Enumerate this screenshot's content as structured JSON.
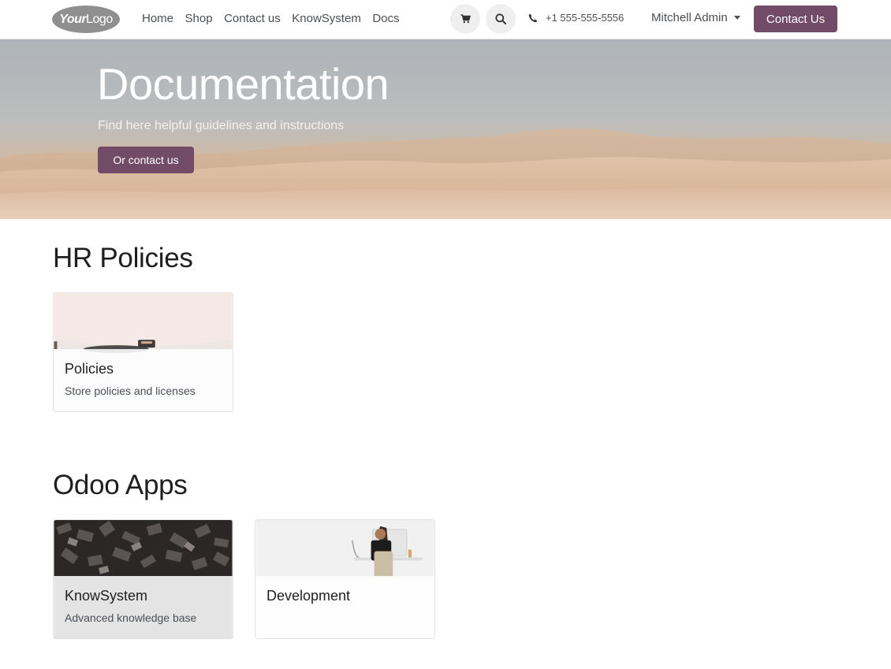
{
  "header": {
    "logo_bold": "Your",
    "logo_light": "Logo",
    "nav": [
      "Home",
      "Shop",
      "Contact us",
      "KnowSystem",
      "Docs"
    ],
    "phone": "+1 555-555-5556",
    "user": "Mitchell Admin",
    "contact_label": "Contact Us"
  },
  "hero": {
    "title": "Documentation",
    "subtitle": "Find here helpful guidelines and instructions",
    "button_label": "Or contact us"
  },
  "sections": [
    {
      "title": "HR Policies",
      "cards": [
        {
          "title": "Policies",
          "description": "Store policies and licenses"
        }
      ]
    },
    {
      "title": "Odoo Apps",
      "cards": [
        {
          "title": "KnowSystem",
          "description": "Advanced knowledge base"
        },
        {
          "title": "Development",
          "description": ""
        }
      ]
    }
  ],
  "colors": {
    "brand": "#714b67",
    "text": "#212529"
  },
  "icons": [
    "cart-icon",
    "search-icon",
    "phone-icon",
    "caret-down-icon"
  ]
}
